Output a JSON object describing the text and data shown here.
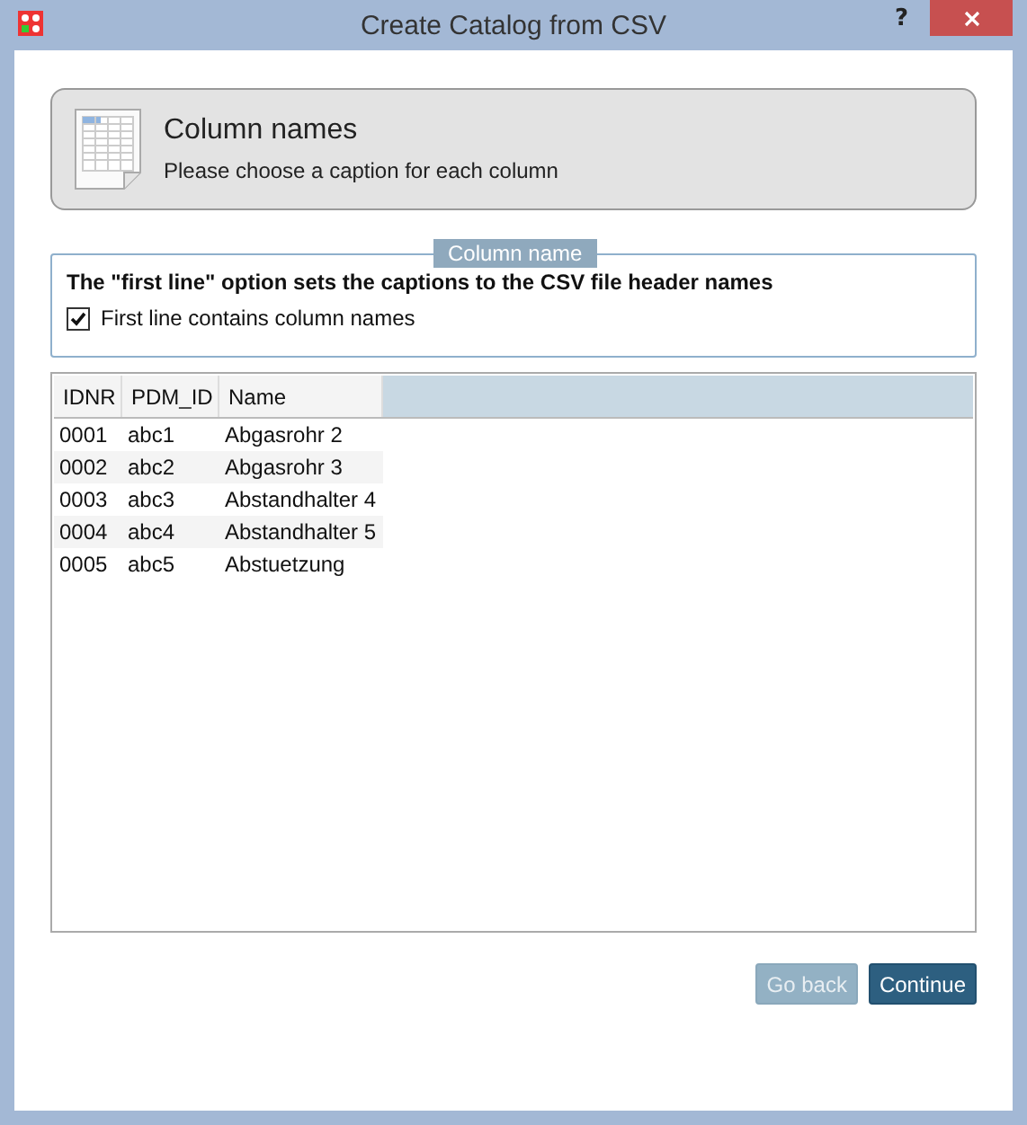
{
  "window": {
    "title": "Create Catalog from CSV",
    "help": "?"
  },
  "header": {
    "title": "Column names",
    "subtitle": "Please choose a caption for each column"
  },
  "group": {
    "legend": "Column name",
    "description": "The \"first line\" option sets the captions to the CSV file header names",
    "checkbox": {
      "label": "First line contains column names",
      "checked": true
    }
  },
  "table": {
    "columns": [
      "IDNR",
      "PDM_ID",
      "Name"
    ],
    "rows": [
      [
        "0001",
        "abc1",
        "Abgasrohr 2"
      ],
      [
        "0002",
        "abc2",
        "Abgasrohr 3"
      ],
      [
        "0003",
        "abc3",
        "Abstandhalter 4"
      ],
      [
        "0004",
        "abc4",
        "Abstandhalter 5"
      ],
      [
        "0005",
        "abc5",
        "Abstuetzung"
      ]
    ]
  },
  "buttons": [
    {
      "label": "Go back",
      "kind": "secondary",
      "disabled": true
    },
    {
      "label": "Continue",
      "kind": "primary",
      "disabled": false
    }
  ]
}
